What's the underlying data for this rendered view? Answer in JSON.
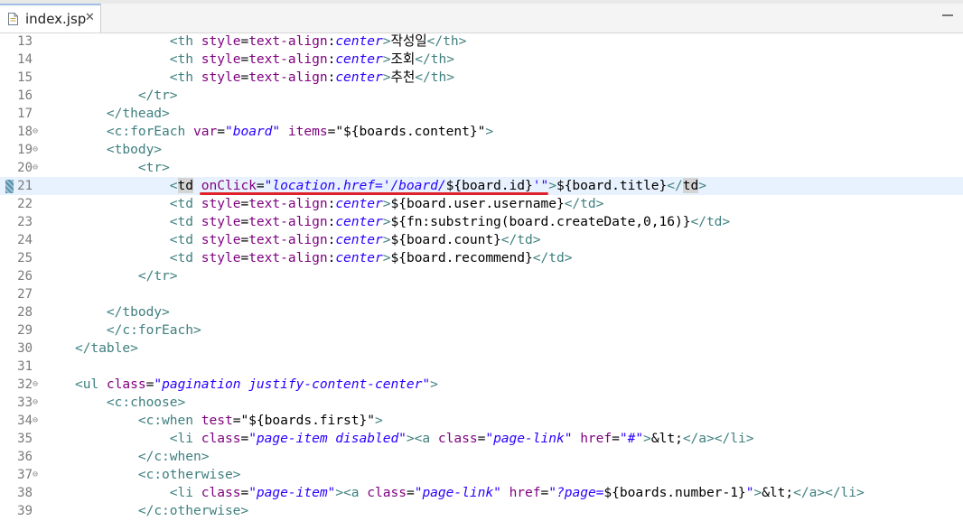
{
  "tab": {
    "title": "index.jsp",
    "close": "✕",
    "icon": "file-icon"
  },
  "current_line": "21",
  "lines": [
    {
      "n": "13",
      "fold": "",
      "s": [
        [
          "t",
          "                "
        ],
        [
          "tg",
          "<th"
        ],
        [
          "t",
          " "
        ],
        [
          "at",
          "style"
        ],
        [
          "t",
          "="
        ],
        [
          "at",
          "text-align"
        ],
        [
          "t",
          ":"
        ],
        [
          "val",
          "center"
        ],
        [
          "tg",
          ">"
        ],
        [
          "t",
          "작성일"
        ],
        [
          "tg",
          "</th>"
        ]
      ]
    },
    {
      "n": "14",
      "fold": "",
      "s": [
        [
          "t",
          "                "
        ],
        [
          "tg",
          "<th"
        ],
        [
          "t",
          " "
        ],
        [
          "at",
          "style"
        ],
        [
          "t",
          "="
        ],
        [
          "at",
          "text-align"
        ],
        [
          "t",
          ":"
        ],
        [
          "val",
          "center"
        ],
        [
          "tg",
          ">"
        ],
        [
          "t",
          "조회"
        ],
        [
          "tg",
          "</th>"
        ]
      ]
    },
    {
      "n": "15",
      "fold": "",
      "s": [
        [
          "t",
          "                "
        ],
        [
          "tg",
          "<th"
        ],
        [
          "t",
          " "
        ],
        [
          "at",
          "style"
        ],
        [
          "t",
          "="
        ],
        [
          "at",
          "text-align"
        ],
        [
          "t",
          ":"
        ],
        [
          "val",
          "center"
        ],
        [
          "tg",
          ">"
        ],
        [
          "t",
          "추천"
        ],
        [
          "tg",
          "</th>"
        ]
      ]
    },
    {
      "n": "16",
      "fold": "",
      "s": [
        [
          "t",
          "            "
        ],
        [
          "tg",
          "</tr>"
        ]
      ]
    },
    {
      "n": "17",
      "fold": "",
      "s": [
        [
          "t",
          "        "
        ],
        [
          "tg",
          "</thead>"
        ]
      ]
    },
    {
      "n": "18",
      "fold": "⊖",
      "s": [
        [
          "t",
          "        "
        ],
        [
          "tg",
          "<c:forEach"
        ],
        [
          "t",
          " "
        ],
        [
          "at",
          "var"
        ],
        [
          "t",
          "="
        ],
        [
          "val",
          "\"board\""
        ],
        [
          "t",
          " "
        ],
        [
          "at",
          "items"
        ],
        [
          "t",
          "=\"${boards.content}\""
        ],
        [
          "tg",
          ">"
        ]
      ]
    },
    {
      "n": "19",
      "fold": "⊖",
      "s": [
        [
          "t",
          "        "
        ],
        [
          "tg",
          "<tbody>"
        ]
      ]
    },
    {
      "n": "20",
      "fold": "⊖",
      "s": [
        [
          "t",
          "            "
        ],
        [
          "tg",
          "<tr>"
        ]
      ]
    },
    {
      "n": "21",
      "fold": "",
      "s": [
        [
          "t",
          "                "
        ],
        [
          "tg",
          "<"
        ],
        [
          "hl",
          "td"
        ],
        [
          "t",
          " "
        ],
        [
          "at",
          "onClick"
        ],
        [
          "t",
          "="
        ],
        [
          "val",
          "\"location.href='/board/"
        ],
        [
          "t",
          "${board.id}"
        ],
        [
          "val",
          "'\""
        ],
        [
          "tg",
          ">"
        ],
        [
          "t",
          "${board.title}"
        ],
        [
          "tg",
          "</"
        ],
        [
          "hl",
          "td"
        ],
        [
          "tg",
          ">"
        ]
      ]
    },
    {
      "n": "22",
      "fold": "",
      "s": [
        [
          "t",
          "                "
        ],
        [
          "tg",
          "<td"
        ],
        [
          "t",
          " "
        ],
        [
          "at",
          "style"
        ],
        [
          "t",
          "="
        ],
        [
          "at",
          "text-align"
        ],
        [
          "t",
          ":"
        ],
        [
          "val",
          "center"
        ],
        [
          "tg",
          ">"
        ],
        [
          "t",
          "${board.user.username}"
        ],
        [
          "tg",
          "</td>"
        ]
      ]
    },
    {
      "n": "23",
      "fold": "",
      "s": [
        [
          "t",
          "                "
        ],
        [
          "tg",
          "<td"
        ],
        [
          "t",
          " "
        ],
        [
          "at",
          "style"
        ],
        [
          "t",
          "="
        ],
        [
          "at",
          "text-align"
        ],
        [
          "t",
          ":"
        ],
        [
          "val",
          "center"
        ],
        [
          "tg",
          ">"
        ],
        [
          "t",
          "${fn:substring(board.createDate,0,16)}"
        ],
        [
          "tg",
          "</td>"
        ]
      ]
    },
    {
      "n": "24",
      "fold": "",
      "s": [
        [
          "t",
          "                "
        ],
        [
          "tg",
          "<td"
        ],
        [
          "t",
          " "
        ],
        [
          "at",
          "style"
        ],
        [
          "t",
          "="
        ],
        [
          "at",
          "text-align"
        ],
        [
          "t",
          ":"
        ],
        [
          "val",
          "center"
        ],
        [
          "tg",
          ">"
        ],
        [
          "t",
          "${board.count}"
        ],
        [
          "tg",
          "</td>"
        ]
      ]
    },
    {
      "n": "25",
      "fold": "",
      "s": [
        [
          "t",
          "                "
        ],
        [
          "tg",
          "<td"
        ],
        [
          "t",
          " "
        ],
        [
          "at",
          "style"
        ],
        [
          "t",
          "="
        ],
        [
          "at",
          "text-align"
        ],
        [
          "t",
          ":"
        ],
        [
          "val",
          "center"
        ],
        [
          "tg",
          ">"
        ],
        [
          "t",
          "${board.recommend}"
        ],
        [
          "tg",
          "</td>"
        ]
      ]
    },
    {
      "n": "26",
      "fold": "",
      "s": [
        [
          "t",
          "            "
        ],
        [
          "tg",
          "</tr>"
        ]
      ]
    },
    {
      "n": "27",
      "fold": "",
      "s": []
    },
    {
      "n": "28",
      "fold": "",
      "s": [
        [
          "t",
          "        "
        ],
        [
          "tg",
          "</tbody>"
        ]
      ]
    },
    {
      "n": "29",
      "fold": "",
      "s": [
        [
          "t",
          "        "
        ],
        [
          "tg",
          "</c:forEach>"
        ]
      ]
    },
    {
      "n": "30",
      "fold": "",
      "s": [
        [
          "t",
          "    "
        ],
        [
          "tg",
          "</table>"
        ]
      ]
    },
    {
      "n": "31",
      "fold": "",
      "s": []
    },
    {
      "n": "32",
      "fold": "⊖",
      "s": [
        [
          "t",
          "    "
        ],
        [
          "tg",
          "<ul"
        ],
        [
          "t",
          " "
        ],
        [
          "at",
          "class"
        ],
        [
          "t",
          "="
        ],
        [
          "val",
          "\"pagination justify-content-center\""
        ],
        [
          "tg",
          ">"
        ]
      ]
    },
    {
      "n": "33",
      "fold": "⊖",
      "s": [
        [
          "t",
          "        "
        ],
        [
          "tg",
          "<c:choose>"
        ]
      ]
    },
    {
      "n": "34",
      "fold": "⊖",
      "s": [
        [
          "t",
          "            "
        ],
        [
          "tg",
          "<c:when"
        ],
        [
          "t",
          " "
        ],
        [
          "at",
          "test"
        ],
        [
          "t",
          "=\"${boards.first}\""
        ],
        [
          "tg",
          ">"
        ]
      ]
    },
    {
      "n": "35",
      "fold": "",
      "s": [
        [
          "t",
          "                "
        ],
        [
          "tg",
          "<li"
        ],
        [
          "t",
          " "
        ],
        [
          "at",
          "class"
        ],
        [
          "t",
          "="
        ],
        [
          "val",
          "\"page-item disabled\""
        ],
        [
          "tg",
          "><a"
        ],
        [
          "t",
          " "
        ],
        [
          "at",
          "class"
        ],
        [
          "t",
          "="
        ],
        [
          "val",
          "\"page-link\""
        ],
        [
          "t",
          " "
        ],
        [
          "at",
          "href"
        ],
        [
          "t",
          "="
        ],
        [
          "val",
          "\"#\""
        ],
        [
          "tg",
          ">"
        ],
        [
          "t",
          "&lt;"
        ],
        [
          "tg",
          "</a></li>"
        ]
      ]
    },
    {
      "n": "36",
      "fold": "",
      "s": [
        [
          "t",
          "            "
        ],
        [
          "tg",
          "</c:when>"
        ]
      ]
    },
    {
      "n": "37",
      "fold": "⊖",
      "s": [
        [
          "t",
          "            "
        ],
        [
          "tg",
          "<c:otherwise>"
        ]
      ]
    },
    {
      "n": "38",
      "fold": "",
      "s": [
        [
          "t",
          "                "
        ],
        [
          "tg",
          "<li"
        ],
        [
          "t",
          " "
        ],
        [
          "at",
          "class"
        ],
        [
          "t",
          "="
        ],
        [
          "val",
          "\"page-item\""
        ],
        [
          "tg",
          "><a"
        ],
        [
          "t",
          " "
        ],
        [
          "at",
          "class"
        ],
        [
          "t",
          "="
        ],
        [
          "val",
          "\"page-link\""
        ],
        [
          "t",
          " "
        ],
        [
          "at",
          "href"
        ],
        [
          "t",
          "="
        ],
        [
          "val",
          "\"?page="
        ],
        [
          "t",
          "${boards.number-1}"
        ],
        [
          "val",
          "\""
        ],
        [
          "tg",
          ">"
        ],
        [
          "t",
          "&lt;"
        ],
        [
          "tg",
          "</a></li>"
        ]
      ]
    },
    {
      "n": "39",
      "fold": "",
      "s": [
        [
          "t",
          "            "
        ],
        [
          "tg",
          "</c:otherwise>"
        ]
      ]
    }
  ]
}
